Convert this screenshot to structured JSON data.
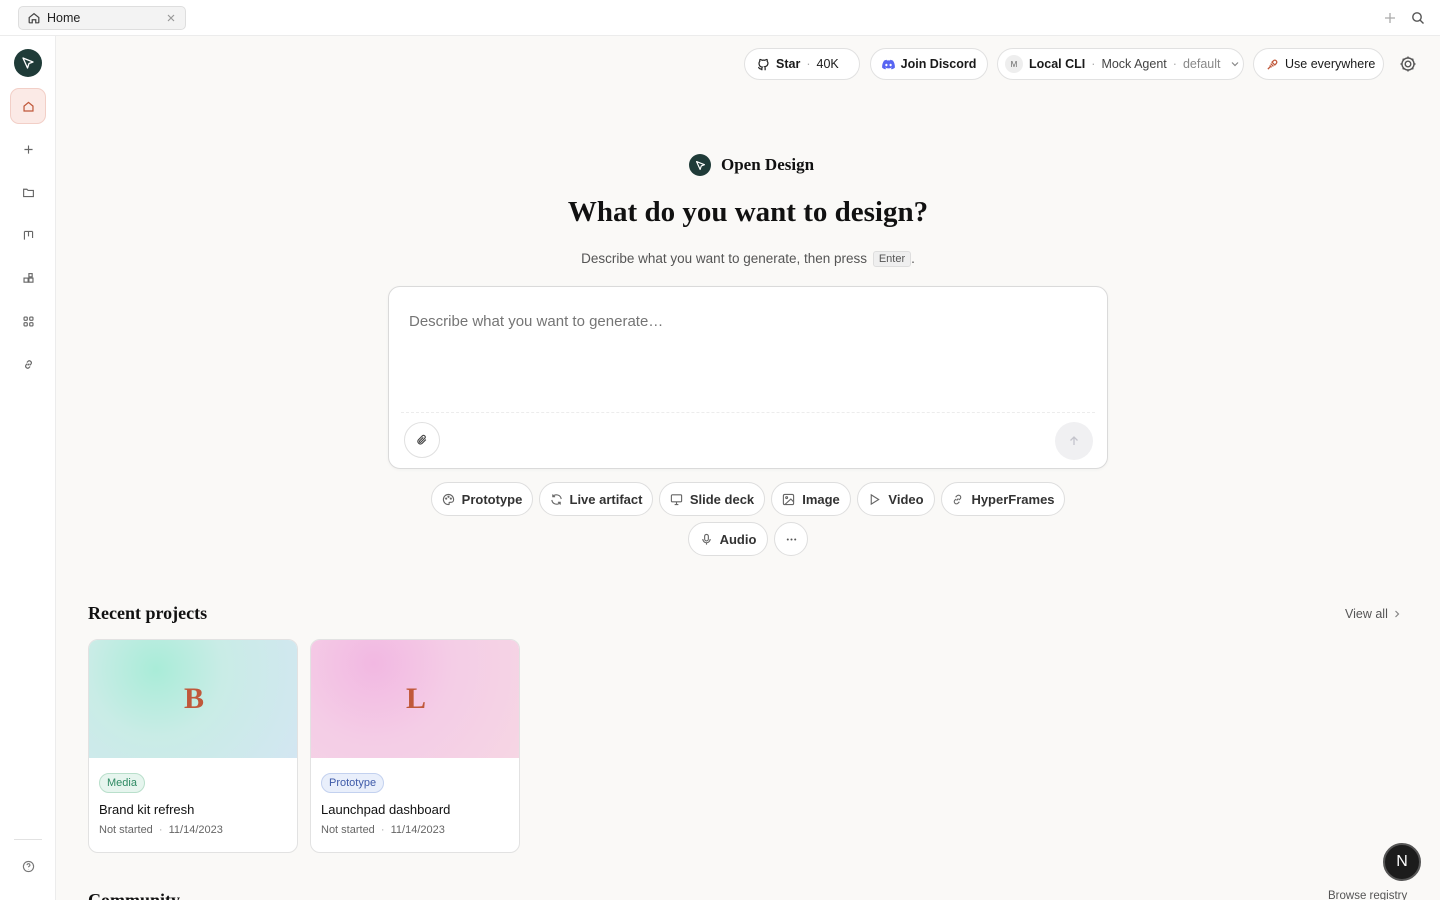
{
  "tab": {
    "label": "Home"
  },
  "header": {
    "star_label": "Star",
    "star_count": "40K",
    "discord_label": "Join Discord",
    "cli_badge": "M",
    "cli_label": "Local CLI",
    "cli_agent": "Mock Agent",
    "cli_profile": "default",
    "use_everywhere_label": "Use everywhere"
  },
  "hero": {
    "brand": "Open Design",
    "headline": "What do you want to design?",
    "subtitle_before": "Describe what you want to generate, then press",
    "subtitle_key": "Enter",
    "subtitle_after": ".",
    "input_placeholder": "Describe what you want to generate…"
  },
  "chips": [
    {
      "label": "Prototype",
      "icon": "palette-icon"
    },
    {
      "label": "Live artifact",
      "icon": "refresh-icon"
    },
    {
      "label": "Slide deck",
      "icon": "monitor-icon"
    },
    {
      "label": "Image",
      "icon": "image-icon"
    },
    {
      "label": "Video",
      "icon": "play-icon"
    },
    {
      "label": "HyperFrames",
      "icon": "link-icon"
    },
    {
      "label": "Audio",
      "icon": "mic-icon"
    }
  ],
  "recent": {
    "title": "Recent projects",
    "view_all": "View all",
    "projects": [
      {
        "letter": "B",
        "tag": "Media",
        "title": "Brand kit refresh",
        "status": "Not started",
        "date": "11/14/2023"
      },
      {
        "letter": "L",
        "tag": "Prototype",
        "title": "Launchpad dashboard",
        "status": "Not started",
        "date": "11/14/2023"
      }
    ]
  },
  "community": {
    "title": "Community",
    "browse": "Browse registry"
  },
  "avatar": {
    "initial": "N"
  },
  "colors": {
    "accent": "#c0583a",
    "logo_bg": "#1f3b38",
    "discord": "#5865f2",
    "media_tag": "#2e8a63",
    "prototype_tag": "#3e5aa8"
  }
}
